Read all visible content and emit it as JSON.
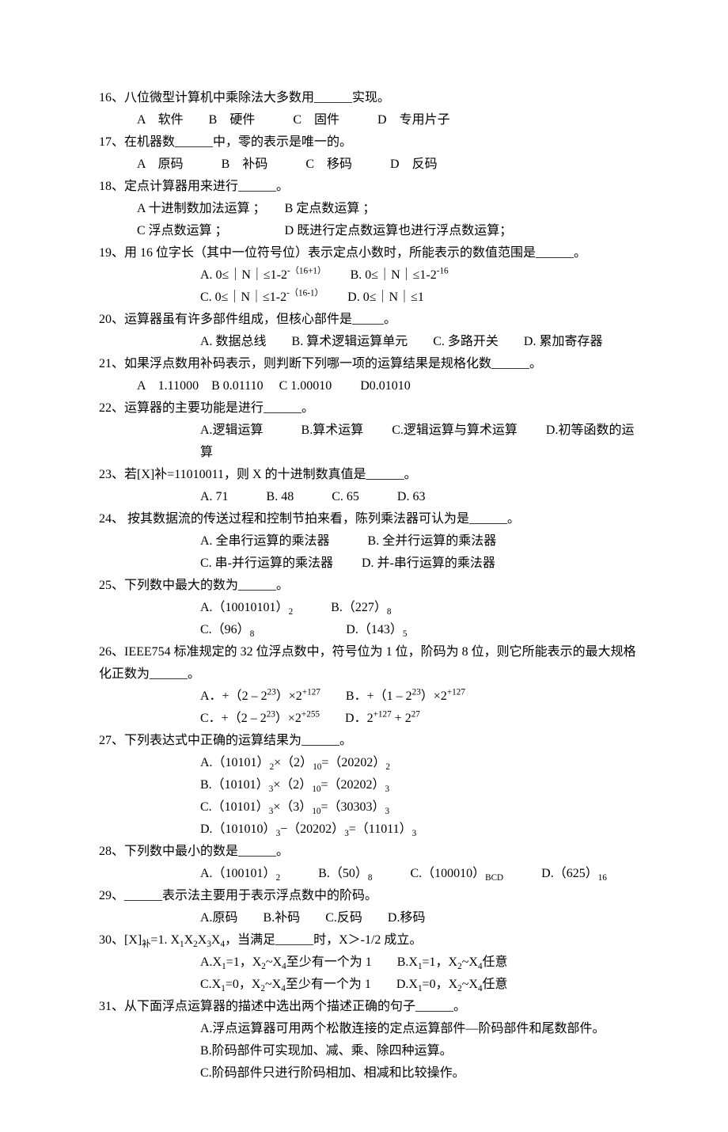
{
  "q16": {
    "stem": "16、八位微型计算机中乘除法大多数用______实现。",
    "opts": "A　软件　　B　硬件　　　C　固件　　　D　专用片子"
  },
  "q17": {
    "stem": "17、在机器数______中，零的表示是唯一的。",
    "opts": "A　原码　　　B　补码　　　C　移码　　　D　反码"
  },
  "q18": {
    "stem": "18、定点计算器用来进行______。",
    "optsA": "A 十进制数加法运算 ；　　B 定点数运算 ；",
    "optsB": "C 浮点数运算 ；　　　　　D 既进行定点数运算也进行浮点数运算；"
  },
  "q19": {
    "stem": "19、用 16 位字长（其中一位符号位）表示定点小数时，所能表示的数值范围是______。",
    "optA_pre": "A. 0≤｜N｜≤1-2",
    "optA_pow": "-（16+1）",
    "optB_pre": "　　 B. 0≤｜N｜≤1-2",
    "optB_pow": "-16",
    "optC_pre": "C. 0≤｜N｜≤1-2",
    "optC_pow": "-（16-1）",
    "optD": "　　 D. 0≤｜N｜≤1"
  },
  "q20": {
    "stem": "20、运算器虽有许多部件组成，但核心部件是_____。",
    "opts": "A. 数据总线　　B. 算术逻辑运算单元　　C. 多路开关　　D. 累加寄存器"
  },
  "q21": {
    "stem": "21、如果浮点数用补码表示，则判断下列哪一项的运算结果是规格化数______。",
    "opts": "A　1.11000　B 0.01110　 C 1.00010　　 D0.01010"
  },
  "q22": {
    "stem": "22、运算器的主要功能是进行______。",
    "opts": "A.逻辑运算　　　B.算术运算　　 C.逻辑运算与算术运算　　 D.初等函数的运算"
  },
  "q23": {
    "stem": "23、若[X]补=11010011，则 X 的十进制数真值是______。",
    "opts": "A. 71　　　B. 48　　　C. 65　　　D. 63"
  },
  "q24": {
    "stem": "24、 按其数据流的传送过程和控制节拍来看，陈列乘法器可认为是______。",
    "optsA": "A. 全串行运算的乘法器　　　B. 全并行运算的乘法器",
    "optsB": "C. 串-并行运算的乘法器　　 D. 并-串行运算的乘法器"
  },
  "q25": {
    "stem": "25、下列数中最大的数为______。",
    "line1_a": "A.（10010101）",
    "line1_a_sub": "2",
    "line1_b": "　　　B.（227）",
    "line1_b_sub": "8",
    "line2_c": "C.（96）",
    "line2_c_sub": "8",
    "line2_d": "　　　　　　　 D.（143）",
    "line2_d_sub": "5"
  },
  "q26": {
    "stem": "26、IEEE754 标准规定的 32 位浮点数中，符号位为 1 位，阶码为 8 位，则它所能表示的最大规格化正数为______。",
    "a_t1": "A．+（2 – 2",
    "a_p1": "23",
    "a_t2": "）×2",
    "a_p2": "+127",
    "b_t1": "　　B．+（1 – 2",
    "b_p1": "23",
    "b_t2": "）×2",
    "b_p2": "+127",
    "c_t1": "C．+（2 – 2",
    "c_p1": "23",
    "c_t2": "）×2",
    "c_p2": "+255",
    "d_t1": "　　D．2",
    "d_p1": "+127",
    "d_t2": " + 2",
    "d_p2": "27"
  },
  "q27": {
    "stem": "27、下列表达式中正确的运算结果为______。",
    "a": {
      "t1": "A.（10101）",
      "s1": "2",
      "t2": "×（2）",
      "s2": "10",
      "t3": "=（20202）",
      "s3": "2"
    },
    "b": {
      "t1": "B.（10101）",
      "s1": "3",
      "t2": "×（2）",
      "s2": "10",
      "t3": "=（20202）",
      "s3": "3"
    },
    "c": {
      "t1": "C.（10101）",
      "s1": "3",
      "t2": "×（3）",
      "s2": "10",
      "t3": "=（30303）",
      "s3": "3"
    },
    "d": {
      "t1": "D.（101010）",
      "s1": "3",
      "t2": "−（20202）",
      "s2": "3",
      "t3": "=（11011）",
      "s3": "3"
    }
  },
  "q28": {
    "stem": "28、下列数中最小的数是______。",
    "a_t": "A.（100101）",
    "a_s": "2",
    "b_t": "　　　B.（50）",
    "b_s": "8",
    "c_t": "　　　C.（100010）",
    "c_s": "BCD",
    "d_t": "　　　D.（625）",
    "d_s": "16"
  },
  "q29": {
    "stem": "29、______表示法主要用于表示浮点数中的阶码。",
    "opts": "A.原码　　B.补码　　C.反码　　D.移码"
  },
  "q30": {
    "stem_t1": "30、[X]",
    "stem_s1": "补",
    "stem_t2": "=1. X",
    "stem_s2": "1",
    "stem_t3": "X",
    "stem_s3": "2",
    "stem_t4": "X",
    "stem_s4": "3",
    "stem_t5": "X",
    "stem_s5": "4",
    "stem_t6": "，当满足______时，X＞-1/2 成立。",
    "l1": {
      "t1": "A.X",
      "s1": "1",
      "t2": "=1，X",
      "s2": "2",
      "t3": "~X",
      "s3": "4",
      "t4": "至少有一个为 1　　B.X",
      "s4": "1",
      "t5": "=1，X",
      "s5": "2",
      "t6": "~X",
      "s6": "4",
      "t7": "任意"
    },
    "l2": {
      "t1": "C.X",
      "s1": "1",
      "t2": "=0，X",
      "s2": "2",
      "t3": "~X",
      "s3": "4",
      "t4": "至少有一个为 1　　D.X",
      "s4": "1",
      "t5": "=0，X",
      "s5": "2",
      "t6": "~X",
      "s6": "4",
      "t7": "任意"
    }
  },
  "q31": {
    "stem": "31、从下面浮点运算器的描述中选出两个描述正确的句子______。",
    "a": "A.浮点运算器可用两个松散连接的定点运算部件—阶码部件和尾数部件。",
    "b": "B.阶码部件可实现加、减、乘、除四种运算。",
    "c": "C.阶码部件只进行阶码相加、相减和比较操作。"
  }
}
